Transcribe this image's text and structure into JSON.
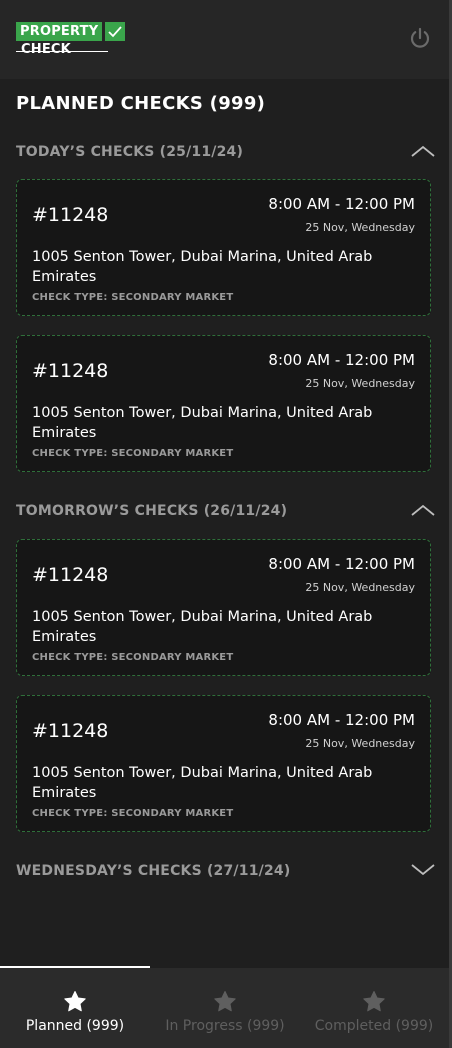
{
  "app": {
    "logo_top": "PROPERTY",
    "logo_bottom": "CHECK",
    "power_icon": "power-icon"
  },
  "page": {
    "title": "PLANNED CHECKS (999)"
  },
  "sections": [
    {
      "label": "TODAY’S CHECKS (25/11/24)",
      "state": "expanded",
      "cards": [
        {
          "id": "#11248",
          "time": "8:00 AM - 12:00 PM",
          "date": "25 Nov, Wednesday",
          "address": "1005 Senton Tower, Dubai Marina, United Arab Emirates",
          "type": "CHECK TYPE: SECONDARY MARKET"
        },
        {
          "id": "#11248",
          "time": "8:00 AM - 12:00 PM",
          "date": "25 Nov, Wednesday",
          "address": "1005 Senton Tower, Dubai Marina, United Arab Emirates",
          "type": "CHECK TYPE: SECONDARY MARKET"
        }
      ]
    },
    {
      "label": "TOMORROW’S CHECKS (26/11/24)",
      "state": "expanded",
      "cards": [
        {
          "id": "#11248",
          "time": "8:00 AM - 12:00 PM",
          "date": "25 Nov, Wednesday",
          "address": "1005 Senton Tower, Dubai Marina, United Arab Emirates",
          "type": "CHECK TYPE: SECONDARY MARKET"
        },
        {
          "id": "#11248",
          "time": "8:00 AM - 12:00 PM",
          "date": "25 Nov, Wednesday",
          "address": "1005 Senton Tower, Dubai Marina, United Arab Emirates",
          "type": "CHECK TYPE: SECONDARY MARKET"
        }
      ]
    },
    {
      "label": "WEDNESDAY’S CHECKS (27/11/24)",
      "state": "collapsed",
      "cards": []
    }
  ],
  "tabs": [
    {
      "label": "Planned (999)",
      "icon": "star-icon",
      "active": true
    },
    {
      "label": "In Progress (999)",
      "icon": "star-icon",
      "active": false
    },
    {
      "label": "Completed (999)",
      "icon": "star-icon",
      "active": false
    }
  ],
  "colors": {
    "background": "#1f1f1f",
    "header": "#262626",
    "card": "#161616",
    "card_border": "#2f6f3a",
    "brand_green": "#3aa54b",
    "muted_text": "#9a9a9a",
    "inactive_tab": "#5f5f5f",
    "tabbar": "#2b2b2b"
  }
}
